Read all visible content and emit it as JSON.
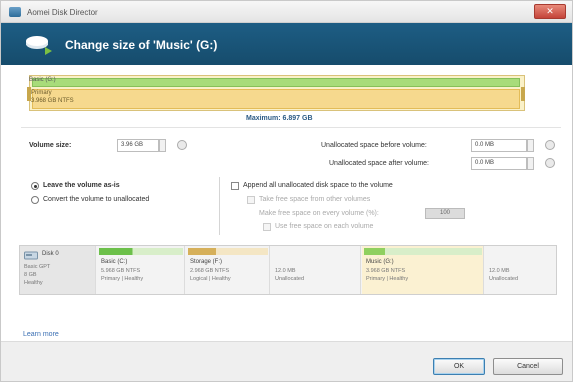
{
  "window": {
    "title": "Aomei Disk Director",
    "close_glyph": "✕"
  },
  "header": {
    "title": "Change size of 'Music' (G:)",
    "icon": "disk-resize-icon"
  },
  "partition_bar": {
    "top_label": "Basic (G:)",
    "mid_label1": "Primary",
    "mid_label2": "3.968 GB NTFS"
  },
  "maximum_label": "Maximum: 6.897 GB",
  "volume_size": {
    "label": "Volume size:",
    "value": "3.96 GB"
  },
  "unalloc_before": {
    "label": "Unallocated space before volume:",
    "value": "0.0 MB"
  },
  "unalloc_after": {
    "label": "Unallocated space after volume:",
    "value": "0.0 MB"
  },
  "radios": [
    {
      "label": "Leave the volume as-is",
      "checked": true
    },
    {
      "label": "Convert the volume to unallocated",
      "checked": false
    }
  ],
  "options": {
    "append": "Append all unallocated disk space to the volume",
    "take_free": "Take free space from other volumes",
    "free_pct": "Make free space on every volume (%):",
    "free_pct_value": "100",
    "use_free": "Use free space on each volume"
  },
  "diskmap": {
    "disk": {
      "name": "Disk 0",
      "type": "Basic GPT",
      "size": "8 GB",
      "status": "Healthy"
    },
    "segments": [
      {
        "title": "Basic (C:)",
        "line1": "5.968 GB NTFS",
        "line2": "Primary | Healthy",
        "color": "#8fd05f"
      },
      {
        "title": "Storage (F:)",
        "line1": "2.968 GB NTFS",
        "line2": "Logical | Healthy",
        "color": "#d6b05a"
      },
      {
        "title": "",
        "line1": "Unallocated",
        "line2": "",
        "color": "#e8e8e8"
      },
      {
        "title": "Music (G:)",
        "line1": "3.968 GB NTFS",
        "line2": "Primary | Healthy",
        "color": "#8fd05f"
      },
      {
        "title": "",
        "line1": "Unallocated",
        "line2": "",
        "color": "#e8e8e8"
      }
    ],
    "extra_labels": [
      "12.0 MB",
      "12.0 MB"
    ]
  },
  "learn_more": "Learn more",
  "buttons": {
    "ok": "OK",
    "cancel": "Cancel"
  }
}
